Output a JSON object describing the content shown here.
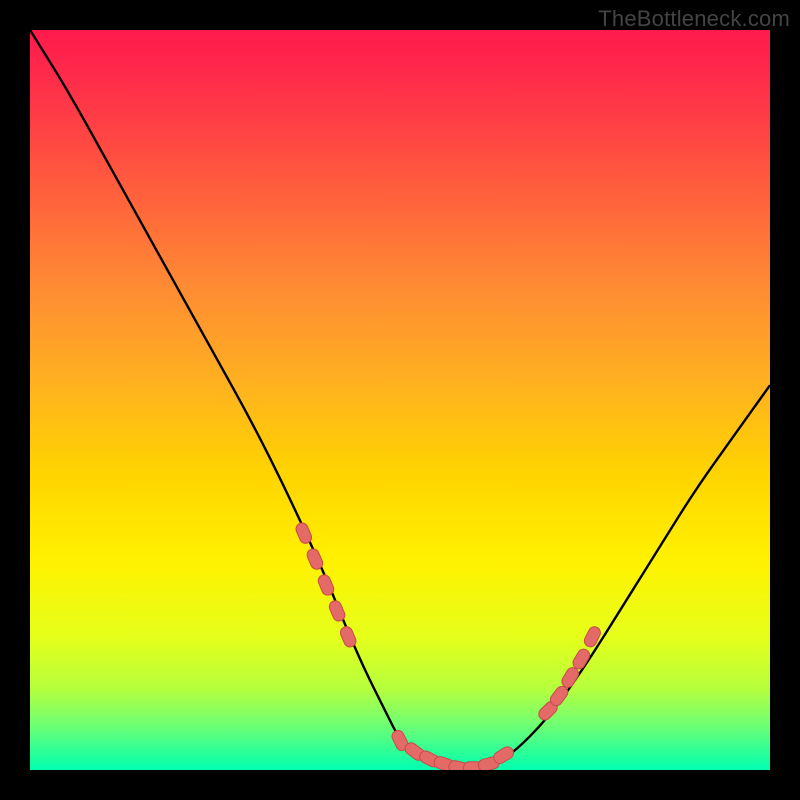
{
  "watermark": "TheBottleneck.com",
  "colors": {
    "page_bg": "#000000",
    "curve": "#000000",
    "marker_fill": "#e46a67",
    "marker_stroke": "#c74a47",
    "gradient_top": "#ff1a4d",
    "gradient_bottom": "#00ffb0"
  },
  "chart_data": {
    "type": "line",
    "title": "",
    "xlabel": "",
    "ylabel": "",
    "xlim": [
      0,
      100
    ],
    "ylim": [
      0,
      100
    ],
    "grid": false,
    "legend": false,
    "series": [
      {
        "name": "curve",
        "x": [
          0,
          5,
          10,
          15,
          20,
          25,
          30,
          35,
          40,
          42,
          45,
          48,
          50,
          52,
          55,
          58,
          60,
          62,
          65,
          70,
          75,
          80,
          85,
          90,
          95,
          100
        ],
        "y": [
          100,
          92,
          83,
          74,
          65,
          56,
          47,
          37,
          26,
          21,
          14,
          8,
          4,
          2,
          0.5,
          0,
          0,
          0.5,
          2,
          7,
          14,
          22,
          30,
          38,
          45,
          52
        ]
      }
    ],
    "markers": {
      "name": "highlighted-points",
      "x": [
        37,
        38.5,
        40,
        41.5,
        43,
        50,
        52,
        54,
        56,
        58,
        60,
        62,
        64,
        70,
        71.5,
        73,
        74.5,
        76
      ],
      "y": [
        32,
        28.5,
        25,
        21.5,
        18,
        4,
        2.5,
        1.5,
        0.8,
        0.3,
        0.3,
        0.8,
        2,
        8,
        10,
        12.5,
        15,
        18
      ]
    }
  }
}
